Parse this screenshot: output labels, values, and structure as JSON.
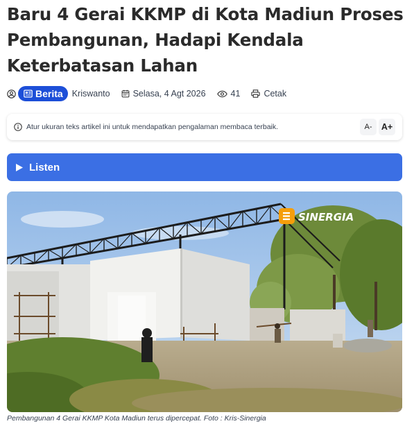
{
  "article": {
    "title": "Baru 4 Gerai KKMP di Kota Madiun Proses Pembangunan, Hadapi Kendala Keterbatasan Lahan",
    "category": "Berita",
    "author": "Kriswanto",
    "date": "Selasa, 4 Agt 2026",
    "views": "41",
    "print_label": "Cetak"
  },
  "notice": {
    "text": "Atur ukuran teks artikel ini untuk mendapatkan pengalaman membaca terbaik.",
    "decrease_label": "A-",
    "increase_label": "A+"
  },
  "listen": {
    "label": "Listen"
  },
  "photo": {
    "watermark": "SINERGIA",
    "caption": "Pembangunan 4 Gerai KKMP Kota Madiun terus dipercepat. Foto : Kris-Sinergia"
  },
  "colors": {
    "accent": "#3b6fe4",
    "badge": "#1d4fd8",
    "watermark": "#f59e0b"
  },
  "icons": [
    "user-icon",
    "newspaper-icon",
    "calendar-icon",
    "eye-icon",
    "printer-icon",
    "info-icon",
    "play-icon"
  ]
}
